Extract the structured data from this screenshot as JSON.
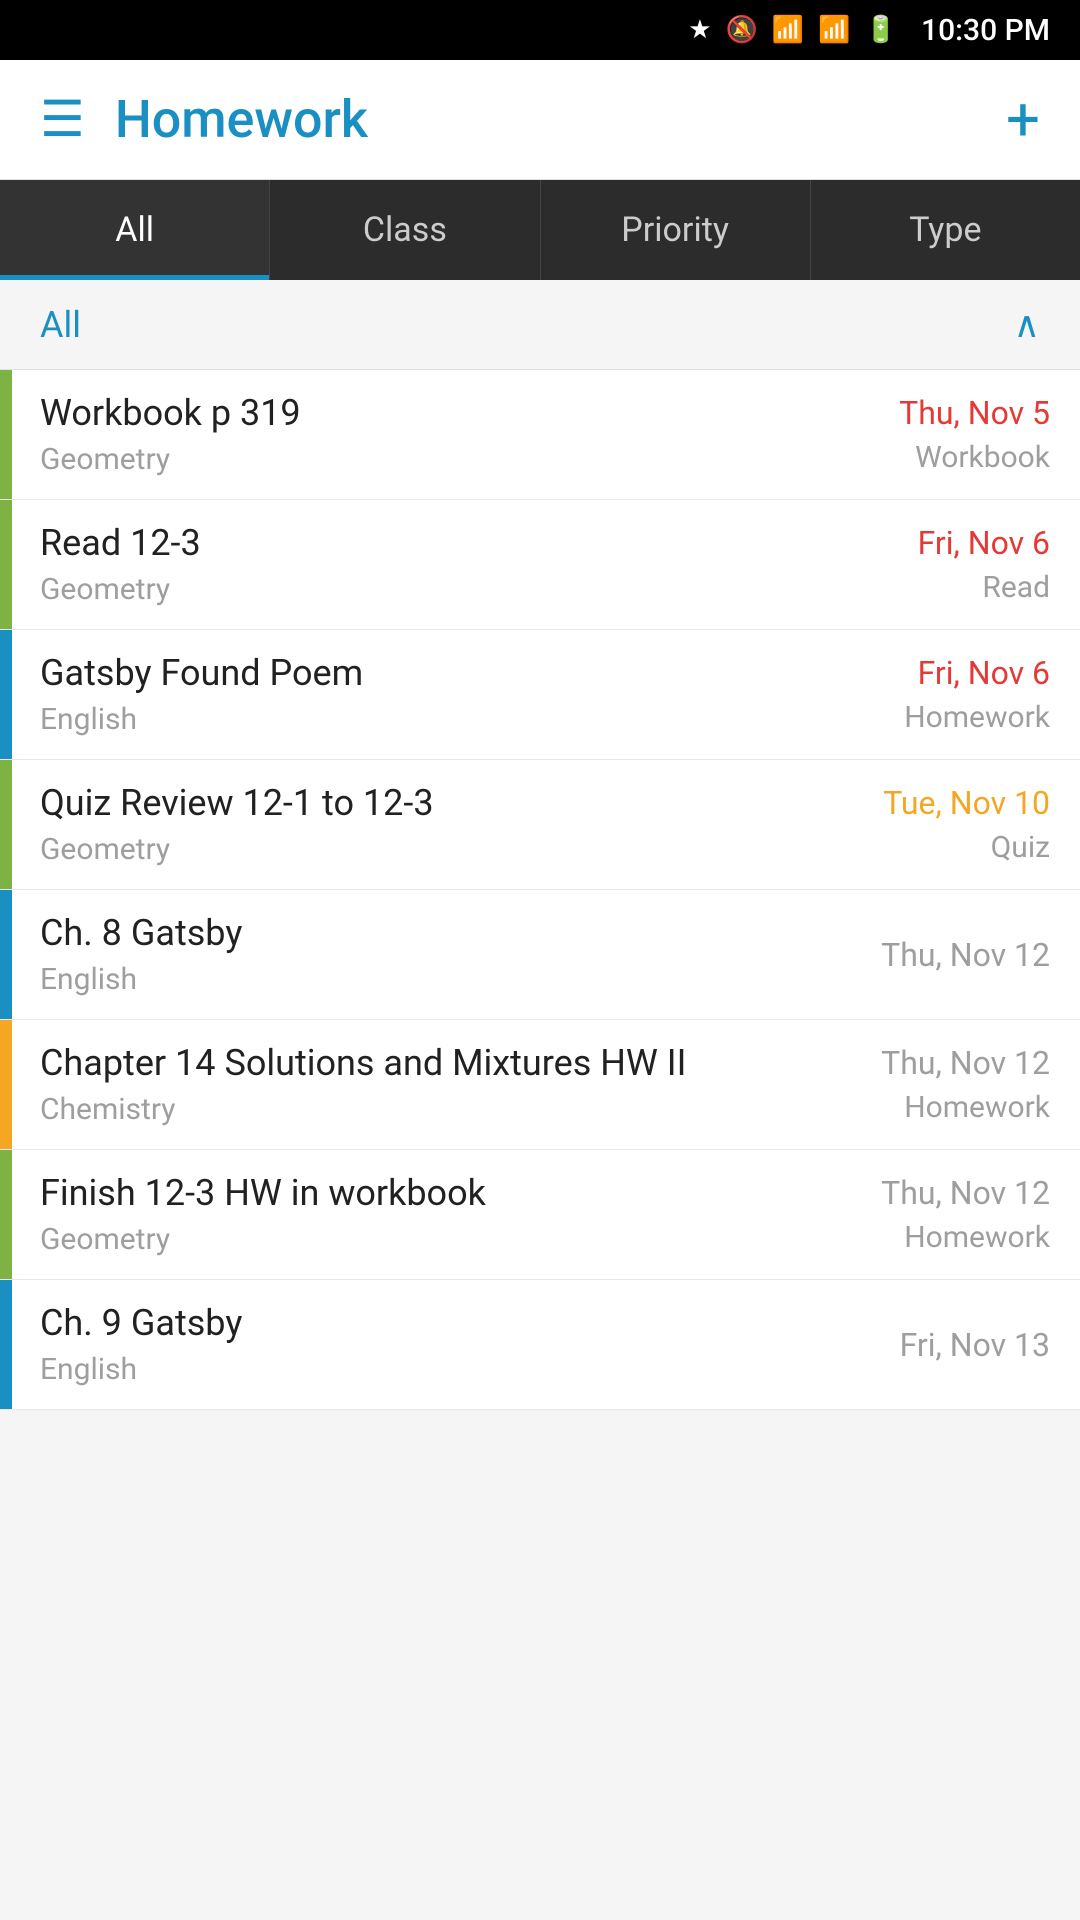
{
  "statusBar": {
    "time": "10:30 PM"
  },
  "appBar": {
    "title": "Homework",
    "menuLabel": "menu",
    "addLabel": "add"
  },
  "tabs": [
    {
      "id": "all",
      "label": "All",
      "active": true
    },
    {
      "id": "class",
      "label": "Class",
      "active": false
    },
    {
      "id": "priority",
      "label": "Priority",
      "active": false
    },
    {
      "id": "type",
      "label": "Type",
      "active": false
    }
  ],
  "filter": {
    "label": "All",
    "chevron": "∧"
  },
  "homeworkItems": [
    {
      "id": 1,
      "title": "Workbook p 319",
      "subject": "Geometry",
      "date": "Thu, Nov 5",
      "dateStyle": "overdue",
      "type": "Workbook",
      "colorBar": "green"
    },
    {
      "id": 2,
      "title": "Read 12-3",
      "subject": "Geometry",
      "date": "Fri, Nov 6",
      "dateStyle": "overdue",
      "type": "Read",
      "colorBar": "green"
    },
    {
      "id": 3,
      "title": "Gatsby Found Poem",
      "subject": "English",
      "date": "Fri, Nov 6",
      "dateStyle": "overdue",
      "type": "Homework",
      "colorBar": "blue"
    },
    {
      "id": 4,
      "title": "Quiz Review 12-1 to 12-3",
      "subject": "Geometry",
      "date": "Tue, Nov 10",
      "dateStyle": "soon",
      "type": "Quiz",
      "colorBar": "green"
    },
    {
      "id": 5,
      "title": "Ch. 8 Gatsby",
      "subject": "English",
      "date": "Thu, Nov 12",
      "dateStyle": "normal",
      "type": "",
      "colorBar": "blue"
    },
    {
      "id": 6,
      "title": "Chapter 14 Solutions and Mixtures HW II",
      "subject": "Chemistry",
      "date": "Thu, Nov 12",
      "dateStyle": "normal",
      "type": "Homework",
      "colorBar": "orange"
    },
    {
      "id": 7,
      "title": "Finish 12-3 HW in workbook",
      "subject": "Geometry",
      "date": "Thu, Nov 12",
      "dateStyle": "normal",
      "type": "Homework",
      "colorBar": "green"
    },
    {
      "id": 8,
      "title": "Ch. 9 Gatsby",
      "subject": "English",
      "date": "Fri, Nov 13",
      "dateStyle": "normal",
      "type": "",
      "colorBar": "blue"
    }
  ]
}
